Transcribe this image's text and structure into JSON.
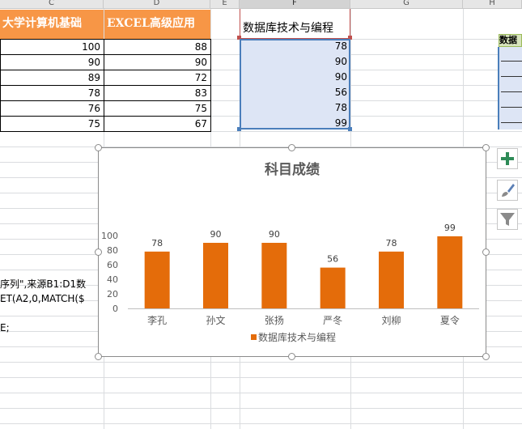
{
  "columns": [
    "C",
    "D",
    "E",
    "F",
    "G",
    "H"
  ],
  "headers": {
    "c": "大学计算机基础",
    "d": "EXCEL高级应用",
    "f": "数据库技术与编程",
    "h": "数据"
  },
  "col_c": [
    "100",
    "90",
    "89",
    "78",
    "76",
    "75"
  ],
  "col_d": [
    "88",
    "90",
    "72",
    "83",
    "75",
    "67"
  ],
  "col_f": [
    "78",
    "90",
    "90",
    "56",
    "78",
    "99"
  ],
  "side_text": [
    "序列\",来源B1:D1数",
    "ET(A2,0,MATCH($",
    "E;"
  ],
  "chart_buttons": {
    "add": "chart-elements",
    "style": "chart-styles",
    "filter": "chart-filters"
  },
  "chart_data": {
    "type": "bar",
    "title": "科目成绩",
    "categories": [
      "李孔",
      "孙文",
      "张扬",
      "严冬",
      "刘柳",
      "夏令"
    ],
    "series": [
      {
        "name": "数据库技术与编程",
        "values": [
          78,
          90,
          90,
          56,
          78,
          99
        ],
        "color": "#e46c0a"
      }
    ],
    "ylim": [
      0,
      100
    ],
    "yticks": [
      0,
      20,
      40,
      60,
      80,
      100
    ],
    "legend": "bottom"
  }
}
